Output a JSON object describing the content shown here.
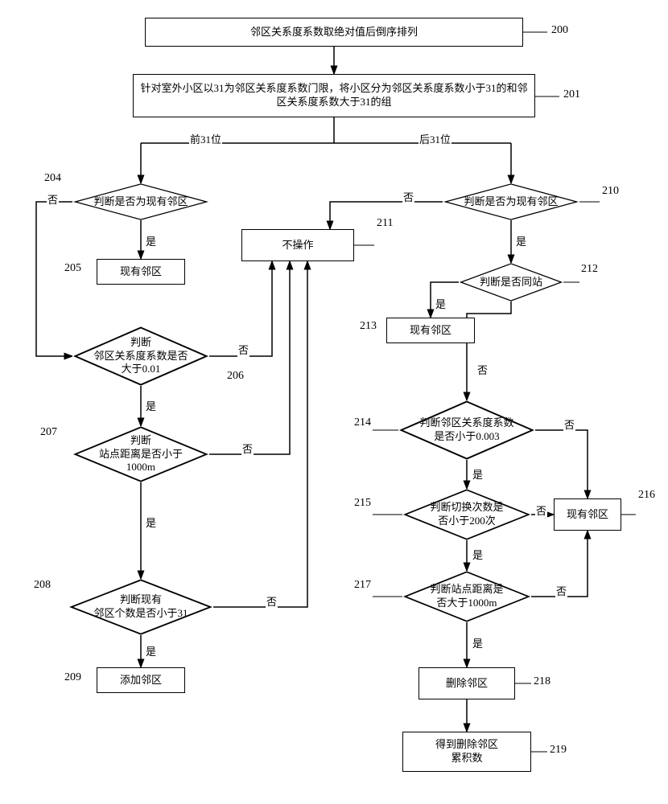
{
  "nodes": {
    "n200": "邻区关系度系数取绝对值后倒序排列",
    "n201": "针对室外小区以31为邻区关系度系数门限，将小区分为邻区关系度系数小于31的和邻区关系度系数大于31的组",
    "n204": "判断是否为现有邻区",
    "n205": "现有邻区",
    "n206": "判断\n邻区关系度系数是否\n大于0.01",
    "n207": "判断\n站点距离是否小于\n1000m",
    "n208": "判断现有\n邻区个数是否小于31",
    "n209": "添加邻区",
    "n210": "判断是否为现有邻区",
    "n211": "不操作",
    "n212": "判断是否同站",
    "n213": "现有邻区",
    "n214": "判断邻区关系度系数\n是否小于0.003",
    "n215": "判断切换次数是\n否小于200次",
    "n216": "现有邻区",
    "n217": "判断站点距离是\n否大于1000m",
    "n218": "删除邻区",
    "n219": "得到删除邻区\n累积数"
  },
  "refs": {
    "r200": "200",
    "r201": "201",
    "r204": "204",
    "r205": "205",
    "r206": "206",
    "r207": "207",
    "r208": "208",
    "r209": "209",
    "r210": "210",
    "r211": "211",
    "r212": "212",
    "r213": "213",
    "r214": "214",
    "r215": "215",
    "r216": "216",
    "r217": "217",
    "r218": "218",
    "r219": "219"
  },
  "edges": {
    "front31": "前31位",
    "back31": "后31位",
    "yes": "是",
    "no": "否"
  }
}
